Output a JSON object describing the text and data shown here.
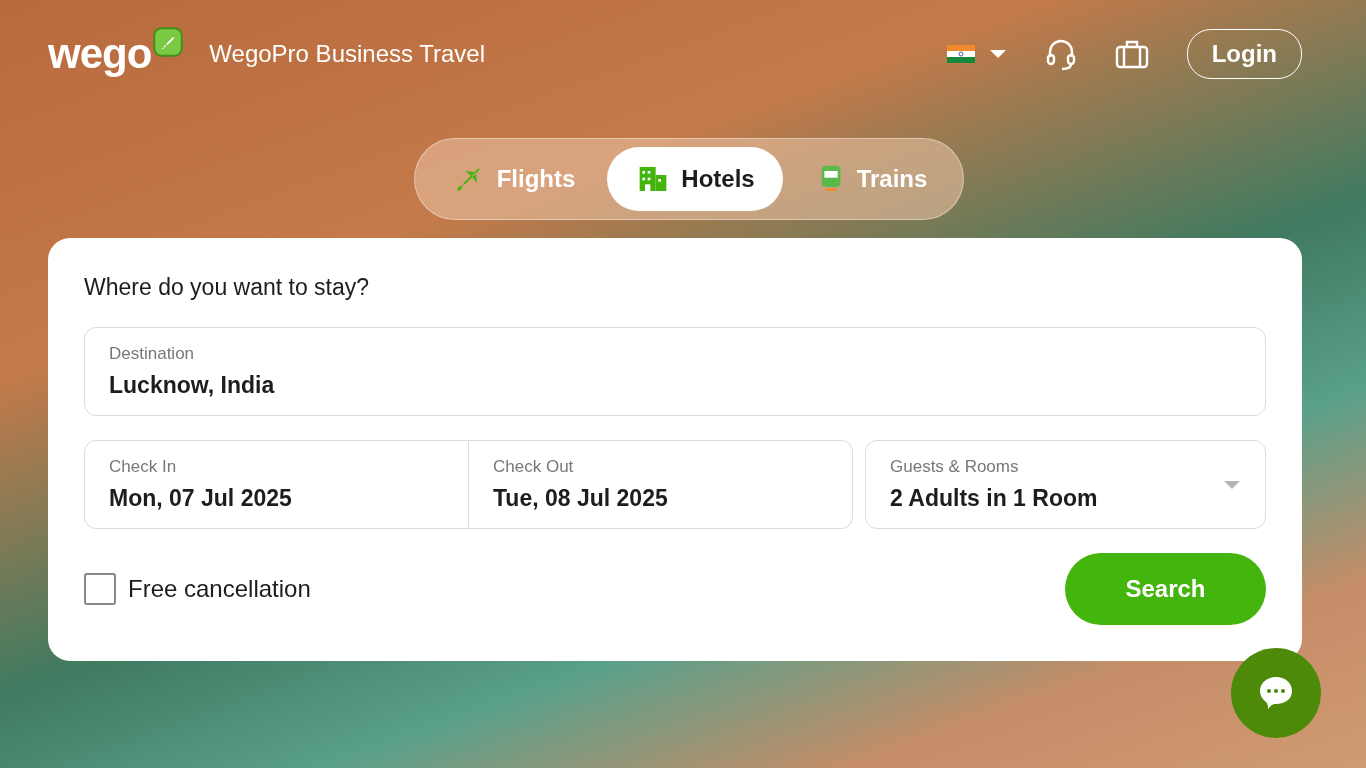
{
  "header": {
    "logo": "wego",
    "tagline": "WegoPro Business Travel",
    "login": "Login"
  },
  "tabs": [
    {
      "label": "Flights",
      "kind": "flight",
      "selected": false
    },
    {
      "label": "Hotels",
      "kind": "hotel",
      "selected": true
    },
    {
      "label": "Trains",
      "kind": "train",
      "selected": false
    }
  ],
  "form": {
    "heading": "Where do you want to stay?",
    "destination": {
      "label": "Destination",
      "value": "Lucknow, India"
    },
    "check_in": {
      "label": "Check In",
      "value": "Mon, 07 Jul 2025"
    },
    "check_out": {
      "label": "Check Out",
      "value": "Tue, 08 Jul 2025"
    },
    "guests": {
      "label": "Guests & Rooms",
      "value": "2 Adults in 1 Room"
    },
    "free_cancellation": {
      "label": "Free cancellation",
      "checked": false
    },
    "search_button": "Search"
  }
}
